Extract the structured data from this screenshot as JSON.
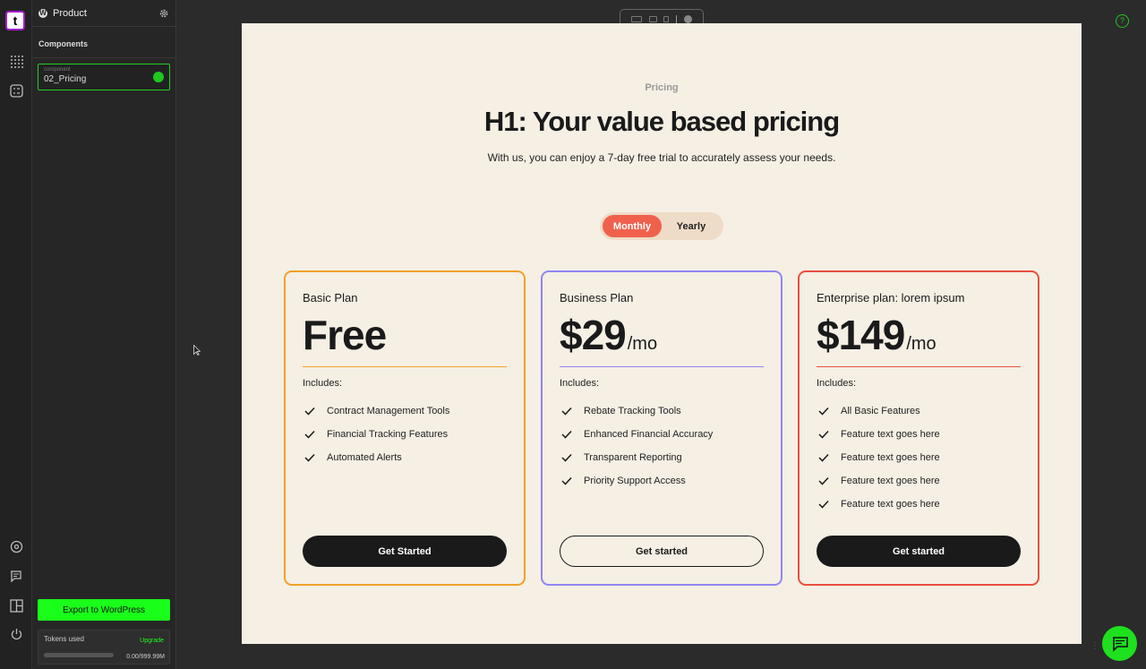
{
  "app": {
    "logo_letter": "t",
    "project_title": "Product",
    "section_title": "Components",
    "component": {
      "tag": "component",
      "name": "02_Pricing"
    },
    "export_label": "Export to WordPress",
    "tokens": {
      "label": "Tokens used",
      "upgrade_label": "Upgrade",
      "value": "0.00/999.99M",
      "fraction": 0
    },
    "help_glyph": "?",
    "accent_color": "#1aff1a"
  },
  "rail_icons": [
    "grid-icon",
    "checklist-icon",
    "target-icon",
    "chat-icon",
    "layout-icon",
    "power-icon"
  ],
  "page": {
    "eyebrow": "Pricing",
    "title": "H1: Your value based pricing",
    "subtitle": "With us, you can enjoy a 7-day free trial to accurately assess your needs.",
    "toggle": {
      "monthly": "Monthly",
      "yearly": "Yearly",
      "selected": "Monthly"
    },
    "plans": [
      {
        "name": "Basic Plan",
        "price": "Free",
        "per": "",
        "includes": "Includes:",
        "features": [
          "Contract Management Tools",
          "Financial Tracking Features",
          "Automated Alerts"
        ],
        "cta": "Get Started",
        "color": "#f0a128"
      },
      {
        "name": "Business Plan",
        "price": "$29",
        "per": "/mo",
        "includes": "Includes:",
        "features": [
          "Rebate Tracking Tools",
          "Enhanced Financial Accuracy",
          "Transparent Reporting",
          "Priority Support Access"
        ],
        "cta": "Get started",
        "color": "#8f86f2"
      },
      {
        "name": "Enterprise plan: lorem ipsum",
        "price": "$149",
        "per": "/mo",
        "includes": "Includes:",
        "features": [
          "All Basic Features",
          "Feature text goes here",
          "Feature text goes here",
          "Feature text goes here",
          "Feature text goes here"
        ],
        "cta": "Get started",
        "color": "#e94f3f"
      }
    ]
  }
}
